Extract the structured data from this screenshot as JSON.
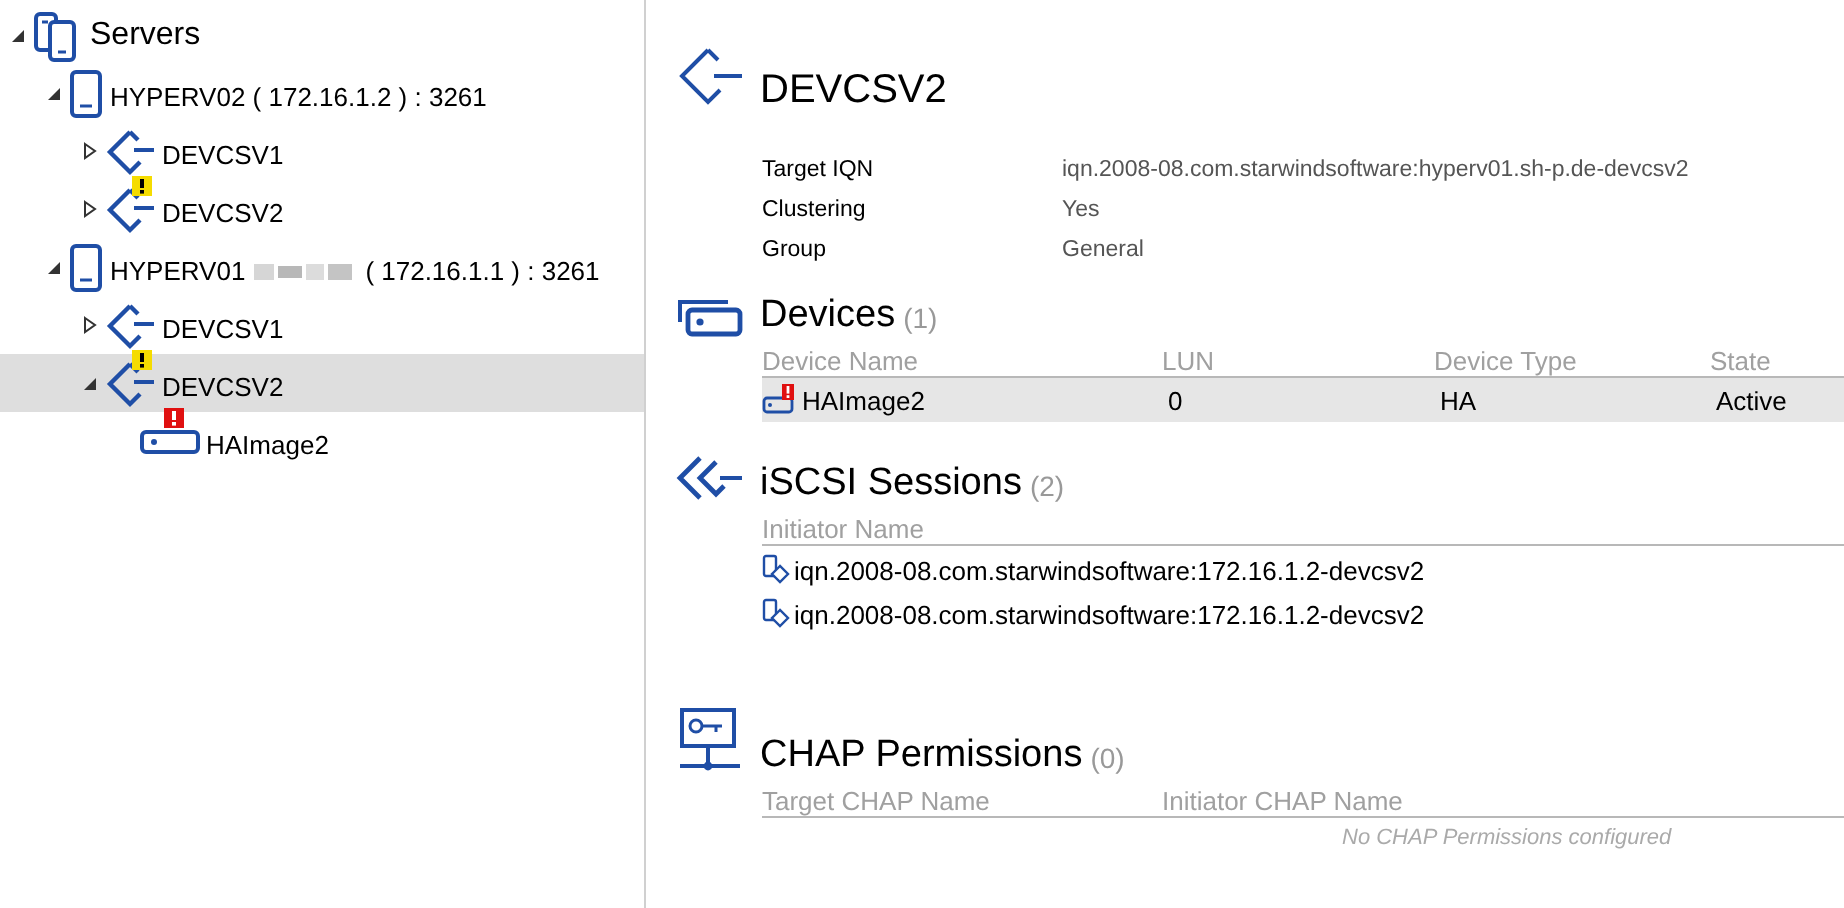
{
  "tree": {
    "kind": "root",
    "label": "Servers",
    "expanded": true,
    "selected": false,
    "children": [
      {
        "kind": "server",
        "label": "HYPERV02 ( 172.16.1.2 ) : 3261",
        "expanded": true,
        "selected": false,
        "children": [
          {
            "kind": "target",
            "label": "DEVCSV1",
            "expanded": false,
            "selected": false,
            "warning": false
          },
          {
            "kind": "target",
            "label": "DEVCSV2",
            "expanded": false,
            "selected": false,
            "warning": true
          }
        ]
      },
      {
        "kind": "server",
        "label": "HYPERV01",
        "redacted": true,
        "suffix": "( 172.16.1.1 ) : 3261",
        "expanded": true,
        "selected": false,
        "children": [
          {
            "kind": "target",
            "label": "DEVCSV1",
            "expanded": false,
            "selected": false,
            "warning": false
          },
          {
            "kind": "target",
            "label": "DEVCSV2",
            "expanded": true,
            "selected": true,
            "warning": true,
            "children": [
              {
                "kind": "device",
                "label": "HAImage2",
                "selected": false,
                "error": true
              }
            ]
          }
        ]
      }
    ]
  },
  "details": {
    "title": "DEVCSV2",
    "properties": [
      {
        "label": "Target IQN",
        "value": "iqn.2008-08.com.starwindsoftware:hyperv01.sh-p.de-devcsv2"
      },
      {
        "label": "Clustering",
        "value": "Yes"
      },
      {
        "label": "Group",
        "value": "General"
      }
    ],
    "devices": {
      "title": "Devices",
      "count": "(1)",
      "columns": [
        "Device Name",
        "LUN",
        "Device Type",
        "State"
      ],
      "rows": [
        {
          "name": "HAImage2",
          "error": true,
          "lun": "0",
          "type": "HA",
          "state": "Active",
          "selected": true
        }
      ]
    },
    "sessions": {
      "title": "iSCSI Sessions",
      "count": "(2)",
      "columns": [
        "Initiator Name"
      ],
      "rows": [
        "iqn.2008-08.com.starwindsoftware:172.16.1.2-devcsv2",
        "iqn.2008-08.com.starwindsoftware:172.16.1.2-devcsv2"
      ]
    },
    "chap": {
      "title": "CHAP Permissions",
      "count": "(0)",
      "columns": [
        "Target CHAP Name",
        "Initiator CHAP Name"
      ],
      "empty_message": "No CHAP Permissions configured"
    }
  }
}
